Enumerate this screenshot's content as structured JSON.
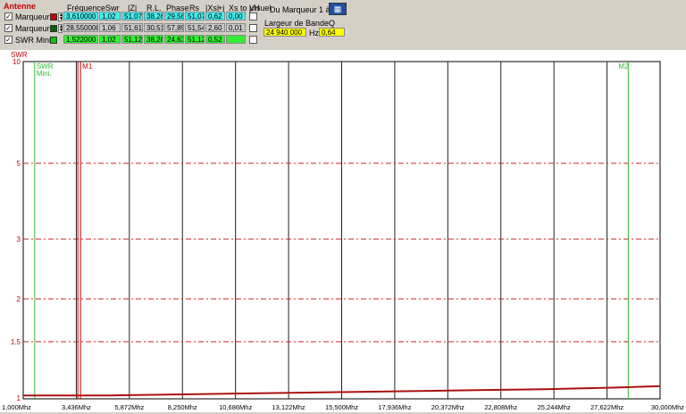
{
  "panel": {
    "section_title": "Antenne",
    "headers": {
      "frequence": "Fréquence",
      "swr": "Swr",
      "z": "|Z|",
      "rl": "R.L.",
      "phase": "Phase",
      "rs": "Rs",
      "xs": "|Xs|",
      "j": "+j",
      "xs_to_uh": "Xs to µH",
      "visuel": "Visuel"
    },
    "rows": [
      {
        "label": "Marqueur 1",
        "checked": true,
        "swatch_color": "#cc0000",
        "row_color": "#44eeee",
        "freq": "3,610000",
        "swr": "1,02",
        "z": "51,07",
        "rl": "38,26",
        "phase": "29,56",
        "rs": "51,07",
        "xs": "0,62",
        "uh": "0,00"
      },
      {
        "label": "Marqueur 2",
        "checked": true,
        "swatch_color": "#006600",
        "row_color": "#c8c8c8",
        "freq": "28,550000",
        "swr": "1,06",
        "z": "51,61",
        "rl": "30,51",
        "phase": "57,89",
        "rs": "51,54",
        "xs": "2,60",
        "uh": "0,01"
      },
      {
        "label": "SWR Mini.",
        "checked": true,
        "swatch_color": "#00cc00",
        "row_color": "#33ee33",
        "freq": "1,522000",
        "swr": "1,02",
        "z": "51,12",
        "rl": "38,26",
        "phase": "24,63",
        "rs": "51,12",
        "xs": "0,52",
        "uh": ""
      }
    ],
    "marker_box": {
      "title": "Du Marqueur 1 à 2",
      "bandwidth_label": "Largeur de Bande",
      "q_label": "Q",
      "bandwidth_value": "24 940 000",
      "unit": "Hz",
      "q_value": "0,64",
      "highlight_color": "#ffff00"
    },
    "calc_icon": "calculator-icon"
  },
  "chart_data": {
    "type": "line",
    "ylabel": "SWR",
    "y_ticks": [
      "10",
      "5",
      "3",
      "2",
      "1.5",
      "1"
    ],
    "x_ticks": [
      "1,000Mhz",
      "3,436Mhz",
      "5,872Mhz",
      "8,250Mhz",
      "10,686Mhz",
      "13,122Mhz",
      "15,500Mhz",
      "17,936Mhz",
      "20,372Mhz",
      "22,808Mhz",
      "25,244Mhz",
      "27,622Mhz",
      "30,000Mhz"
    ],
    "markers": [
      {
        "label": "SWR",
        "sublabel": "Mini.",
        "freq_mhz": 1.522,
        "color": "#33bb33"
      },
      {
        "label": "M1",
        "sublabel": "",
        "freq_mhz": 3.61,
        "color": "#cc0000"
      },
      {
        "label": "M2",
        "sublabel": "",
        "freq_mhz": 28.55,
        "color": "#33bb33"
      }
    ],
    "series": [
      {
        "color": "#aa1111",
        "x": [
          1.0,
          5.0,
          10.0,
          15.0,
          20.0,
          25.0,
          28.0,
          30.0
        ],
        "y": [
          1.02,
          1.02,
          1.03,
          1.04,
          1.05,
          1.06,
          1.07,
          1.08
        ]
      }
    ],
    "xlim": [
      1.0,
      30.0
    ],
    "grid": "dashed-horizontal, solid-vertical"
  }
}
